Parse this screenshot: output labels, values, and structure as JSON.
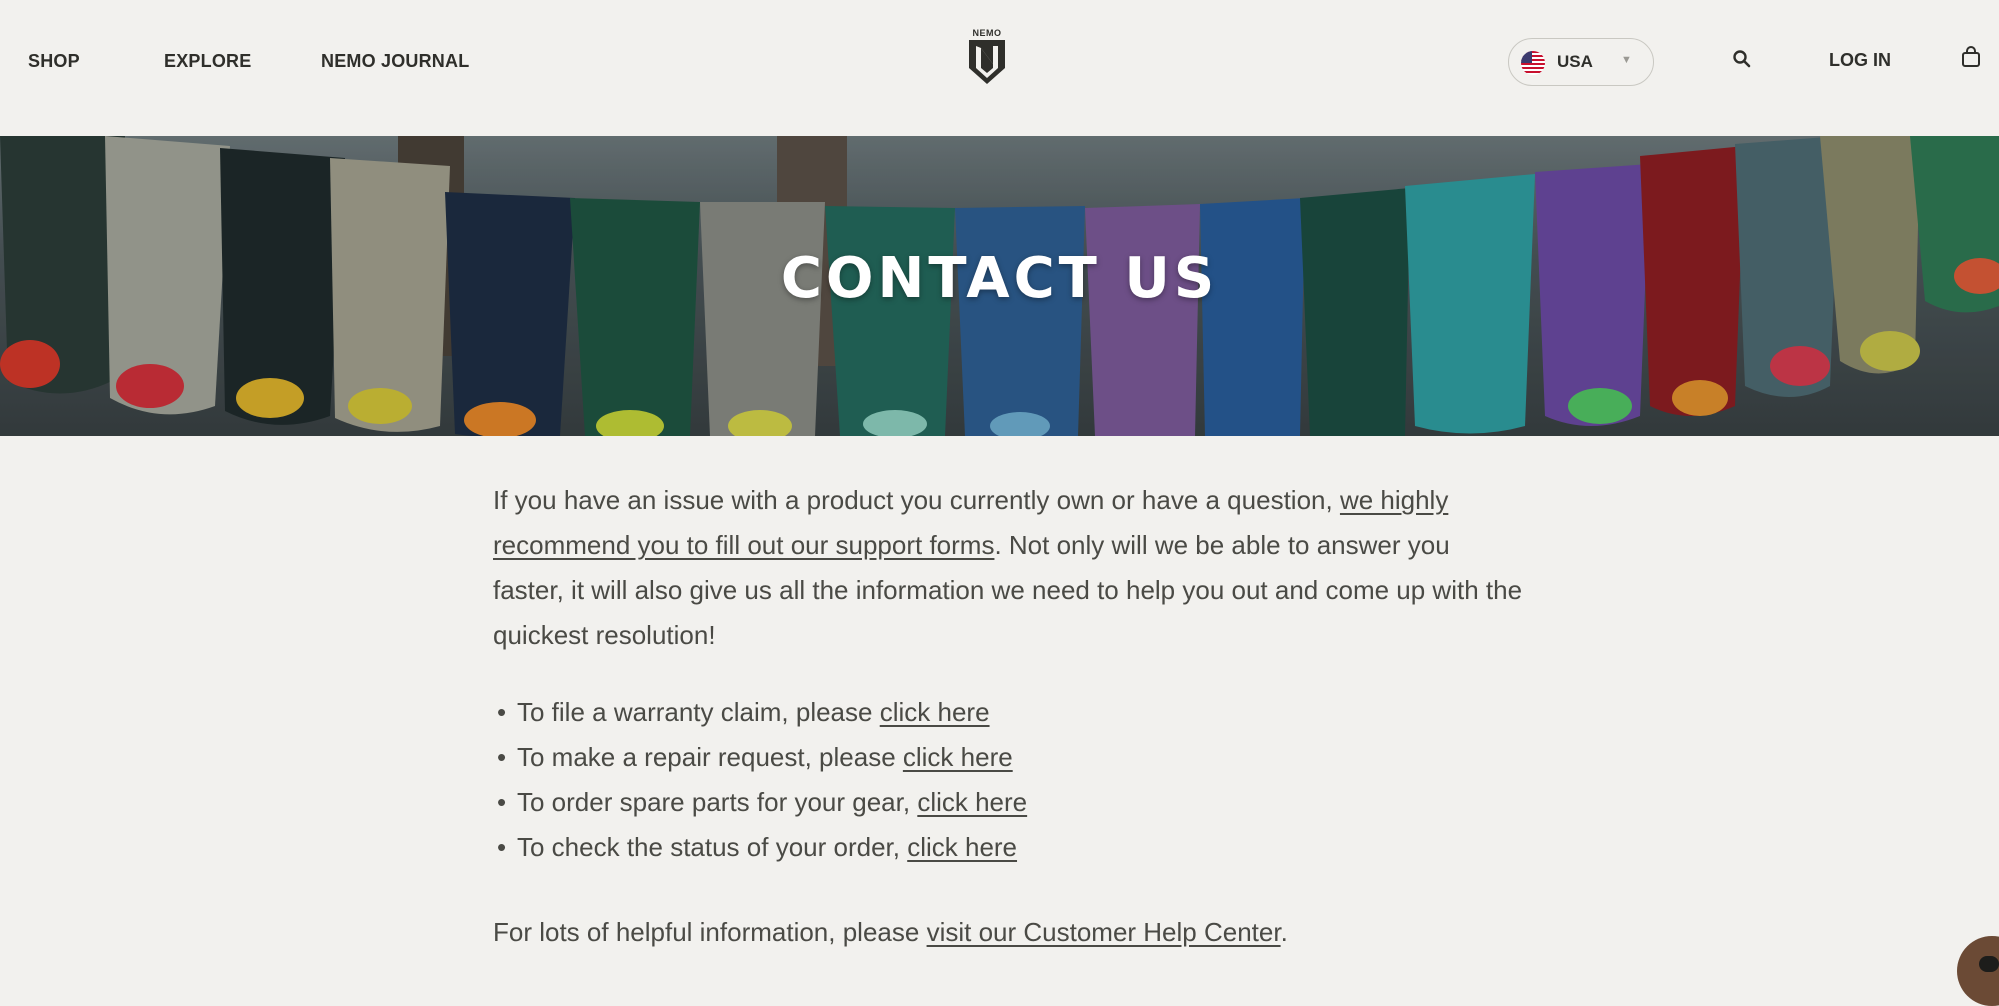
{
  "header": {
    "nav": [
      "SHOP",
      "EXPLORE",
      "NEMO JOURNAL"
    ],
    "logo_text": "NEMO",
    "country": "USA",
    "login": "LOG IN"
  },
  "hero": {
    "title": "CONTACT US"
  },
  "content": {
    "intro_before": "If you have an issue with a product you currently own or have a question, ",
    "intro_link": "we highly recommend you to fill out our support forms",
    "intro_after": ". Not only will we be able to answer you faster, it will also give us all the information we need to help you out and come up with the quickest resolution!",
    "bullets": [
      {
        "text": "To file a warranty claim, please ",
        "link": "click here"
      },
      {
        "text": "To make a repair request, please ",
        "link": "click here"
      },
      {
        "text": "To order spare parts for your gear, ",
        "link": "click here"
      },
      {
        "text": "To check the status of your order, ",
        "link": "click here"
      }
    ],
    "help_before": "For lots of helpful information, please ",
    "help_link": "visit our Customer Help Center",
    "help_after": "."
  },
  "icons": {
    "search": "search-icon",
    "cart": "bag-icon",
    "flag": "us-flag-icon",
    "caret": "caret-down-icon",
    "chat": "chat-icon"
  },
  "colors": {
    "background": "#f2f1ee",
    "text": "#4a4a45"
  }
}
